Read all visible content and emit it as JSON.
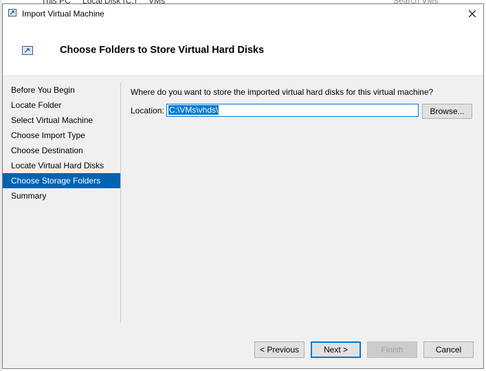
{
  "background": {
    "breadcrumb": [
      "This PC",
      "Local Disk (C:)",
      "VMs"
    ],
    "search_placeholder": "Search VMs"
  },
  "window": {
    "title": "Import Virtual Machine",
    "close_icon": "close-icon"
  },
  "header": {
    "title": "Choose Folders to Store Virtual Hard Disks"
  },
  "nav": {
    "items": [
      {
        "label": "Before You Begin",
        "active": false
      },
      {
        "label": "Locate Folder",
        "active": false
      },
      {
        "label": "Select Virtual Machine",
        "active": false
      },
      {
        "label": "Choose Import Type",
        "active": false
      },
      {
        "label": "Choose Destination",
        "active": false
      },
      {
        "label": "Locate Virtual Hard Disks",
        "active": false
      },
      {
        "label": "Choose Storage Folders",
        "active": true
      },
      {
        "label": "Summary",
        "active": false
      }
    ]
  },
  "content": {
    "question": "Where do you want to store the imported virtual hard disks for this virtual machine?",
    "location_label": "Location:",
    "location_value": "C:\\VMs\\vhds\\",
    "browse_label": "Browse..."
  },
  "footer": {
    "previous_label": "< Previous",
    "next_label": "Next >",
    "finish_label": "Finish",
    "cancel_label": "Cancel"
  },
  "colors": {
    "accent": "#0078d7",
    "nav_active": "#0063b1"
  }
}
